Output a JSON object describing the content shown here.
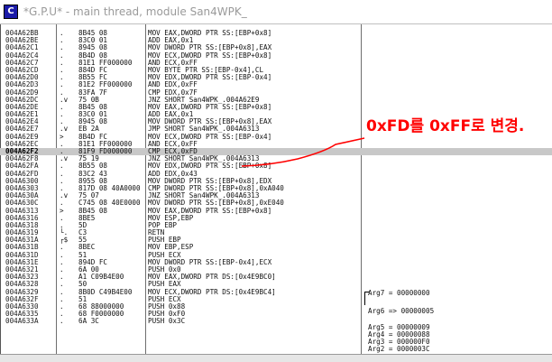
{
  "window": {
    "title": "*G.P.U* - main thread, module San4WPK_",
    "icon_letter": "C",
    "icon": "olly-app-icon"
  },
  "annotation": {
    "text": "0xFD를 0xFF로 변경.",
    "color": "#ff0000"
  },
  "rows": [
    {
      "addr": "004A62BB",
      "mark": ".",
      "hex": "8B45 08",
      "dis": "MOV EAX,DWORD PTR SS:[EBP+0x8]"
    },
    {
      "addr": "004A62BE",
      "mark": ".",
      "hex": "83C0 01",
      "dis": "ADD EAX,0x1"
    },
    {
      "addr": "004A62C1",
      "mark": ".",
      "hex": "8945 08",
      "dis": "MOV DWORD PTR SS:[EBP+0x8],EAX"
    },
    {
      "addr": "004A62C4",
      "mark": ".",
      "hex": "8B4D 08",
      "dis": "MOV ECX,DWORD PTR SS:[EBP+0x8]"
    },
    {
      "addr": "004A62C7",
      "mark": ".",
      "hex": "81E1 FF000000",
      "dis": "AND ECX,0xFF"
    },
    {
      "addr": "004A62CD",
      "mark": ".",
      "hex": "884D FC",
      "dis": "MOV BYTE PTR SS:[EBP-0x4],CL"
    },
    {
      "addr": "004A62D0",
      "mark": ".",
      "hex": "8B55 FC",
      "dis": "MOV EDX,DWORD PTR SS:[EBP-0x4]"
    },
    {
      "addr": "004A62D3",
      "mark": ".",
      "hex": "81E2 FF000000",
      "dis": "AND EDX,0xFF"
    },
    {
      "addr": "004A62D9",
      "mark": ".",
      "hex": "83FA 7F",
      "dis": "CMP EDX,0x7F"
    },
    {
      "addr": "004A62DC",
      "mark": ".v",
      "hex": "75 0B",
      "dis": "JNZ SHORT San4WPK_.004A62E9"
    },
    {
      "addr": "004A62DE",
      "mark": ".",
      "hex": "8B45 08",
      "dis": "MOV EAX,DWORD PTR SS:[EBP+0x8]"
    },
    {
      "addr": "004A62E1",
      "mark": ".",
      "hex": "83C0 01",
      "dis": "ADD EAX,0x1"
    },
    {
      "addr": "004A62E4",
      "mark": ".",
      "hex": "8945 08",
      "dis": "MOV DWORD PTR SS:[EBP+0x8],EAX"
    },
    {
      "addr": "004A62E7",
      "mark": ".v",
      "hex": "EB 2A",
      "dis": "JMP SHORT San4WPK_.004A6313"
    },
    {
      "addr": "004A62E9",
      "mark": ">",
      "hex": "8B4D FC",
      "dis": "MOV ECX,DWORD PTR SS:[EBP-0x4]"
    },
    {
      "addr": "004A62EC",
      "mark": ".",
      "hex": "81E1 FF000000",
      "dis": "AND ECX,0xFF"
    },
    {
      "addr": "004A62F2",
      "mark": ".",
      "hex": "81F9 FD000000",
      "dis": "CMP ECX,0xFD",
      "selected": true
    },
    {
      "addr": "004A62F8",
      "mark": ".v",
      "hex": "75 19",
      "dis": "JNZ SHORT San4WPK_.004A6313"
    },
    {
      "addr": "004A62FA",
      "mark": ".",
      "hex": "8B55 08",
      "dis": "MOV EDX,DWORD PTR SS:[EBP+0x8]"
    },
    {
      "addr": "004A62FD",
      "mark": ".",
      "hex": "83C2 43",
      "dis": "ADD EDX,0x43"
    },
    {
      "addr": "004A6300",
      "mark": ".",
      "hex": "8955 08",
      "dis": "MOV DWORD PTR SS:[EBP+0x8],EDX"
    },
    {
      "addr": "004A6303",
      "mark": ".",
      "hex": "817D 08 40A0000",
      "dis": "CMP DWORD PTR SS:[EBP+0x8],0xA040"
    },
    {
      "addr": "004A630A",
      "mark": ".v",
      "hex": "75 07",
      "dis": "JNZ SHORT San4WPK_.004A6313"
    },
    {
      "addr": "004A630C",
      "mark": ".",
      "hex": "C745 08 40E0000",
      "dis": "MOV DWORD PTR SS:[EBP+0x8],0xE040"
    },
    {
      "addr": "004A6313",
      "mark": ">",
      "hex": "8B45 08",
      "dis": "MOV EAX,DWORD PTR SS:[EBP+0x8]"
    },
    {
      "addr": "004A6316",
      "mark": ".",
      "hex": "8BE5",
      "dis": "MOV ESP,EBP"
    },
    {
      "addr": "004A6318",
      "mark": ".",
      "hex": "5D",
      "dis": "POP EBP"
    },
    {
      "addr": "004A6319",
      "mark": "└.",
      "hex": "C3",
      "dis": "RETN"
    },
    {
      "addr": "004A631A",
      "mark": "┌$",
      "hex": "55",
      "dis": "PUSH EBP"
    },
    {
      "addr": "004A631B",
      "mark": ".",
      "hex": "8BEC",
      "dis": "MOV EBP,ESP"
    },
    {
      "addr": "004A631D",
      "mark": ".",
      "hex": "51",
      "dis": "PUSH ECX"
    },
    {
      "addr": "004A631E",
      "mark": ".",
      "hex": "894D FC",
      "dis": "MOV DWORD PTR SS:[EBP-0x4],ECX"
    },
    {
      "addr": "004A6321",
      "mark": ".",
      "hex": "6A 00",
      "dis": "PUSH 0x0"
    },
    {
      "addr": "004A6323",
      "mark": ".",
      "hex": "A1 C09B4E00",
      "dis": "MOV EAX,DWORD PTR DS:[0x4E9BC0]"
    },
    {
      "addr": "004A6328",
      "mark": ".",
      "hex": "50",
      "dis": "PUSH EAX"
    },
    {
      "addr": "004A6329",
      "mark": ".",
      "hex": "8B0D C49B4E00",
      "dis": "MOV ECX,DWORD PTR DS:[0x4E9BC4]"
    },
    {
      "addr": "004A632F",
      "mark": ".",
      "hex": "51",
      "dis": "PUSH ECX"
    },
    {
      "addr": "004A6330",
      "mark": ".",
      "hex": "68 88000000",
      "dis": "PUSH 0x88"
    },
    {
      "addr": "004A6335",
      "mark": ".",
      "hex": "68 F0000000",
      "dis": "PUSH 0xF0"
    },
    {
      "addr": "004A633A",
      "mark": ".",
      "hex": "6A 3C",
      "dis": "PUSH 0x3C"
    }
  ],
  "args": [
    {
      "text": "Arg7 = 00000000"
    },
    {
      "text": "Arg6 => 00000005"
    },
    {
      "text": "Arg5 = 00000009"
    },
    {
      "text": "Arg4 = 00000088"
    },
    {
      "text": "Arg3 = 000000F0"
    },
    {
      "text": "Arg2 = 0000003C"
    }
  ]
}
